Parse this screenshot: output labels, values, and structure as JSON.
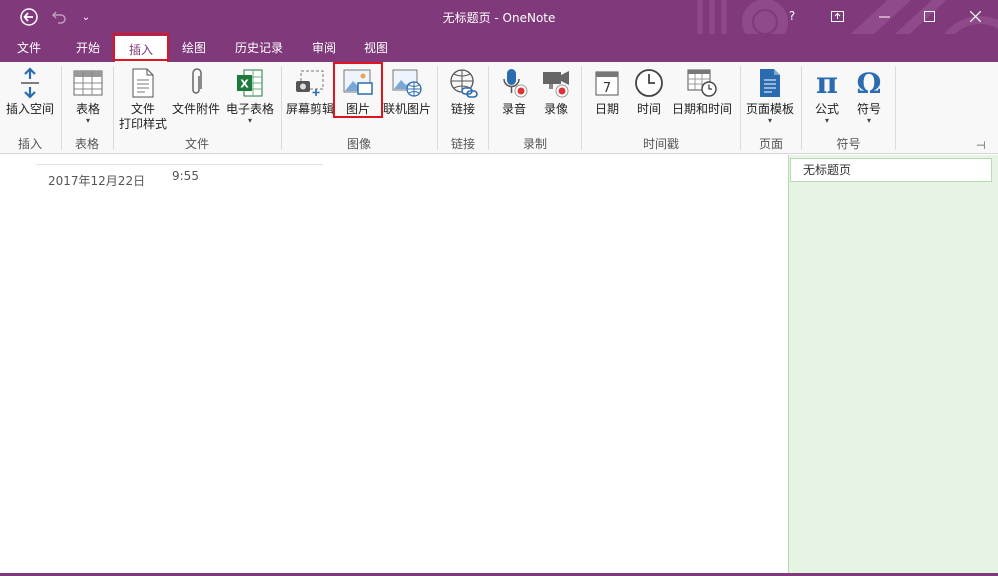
{
  "window": {
    "title": "无标题页 - OneNote",
    "help": "?"
  },
  "tabs": [
    "文件",
    "开始",
    "插入",
    "绘图",
    "历史记录",
    "审阅",
    "视图"
  ],
  "active_tab": "插入",
  "ribbon": {
    "buttons": {
      "insert_space": "插入空间",
      "table": "表格",
      "file_printout": [
        "文件",
        "打印样式"
      ],
      "file_attachment": "文件附件",
      "spreadsheet": "电子表格",
      "screen_clipping": "屏幕剪辑",
      "picture": "图片",
      "online_picture": "联机图片",
      "link": "链接",
      "audio": "录音",
      "video": "录像",
      "date": "日期",
      "time": "时间",
      "date_time": "日期和时间",
      "page_templates": "页面模板",
      "equation": "公式",
      "symbol": "符号"
    },
    "groups": {
      "insert": "插入",
      "tables": "表格",
      "files": "文件",
      "images": "图像",
      "links": "链接",
      "recording": "录制",
      "timestamp": "时间戳",
      "pages": "页面",
      "symbols": "符号"
    }
  },
  "page": {
    "date": "2017年12月22日",
    "time": "9:55"
  },
  "page_list": {
    "items": [
      "无标题页"
    ]
  },
  "colors": {
    "brand": "#80397b",
    "highlight": "#e0141e",
    "pane": "#e6f4e3"
  },
  "icons": {
    "spreadsheet_letter": "X",
    "pi": "π",
    "omega": "Ω",
    "calendar_day": "7"
  }
}
